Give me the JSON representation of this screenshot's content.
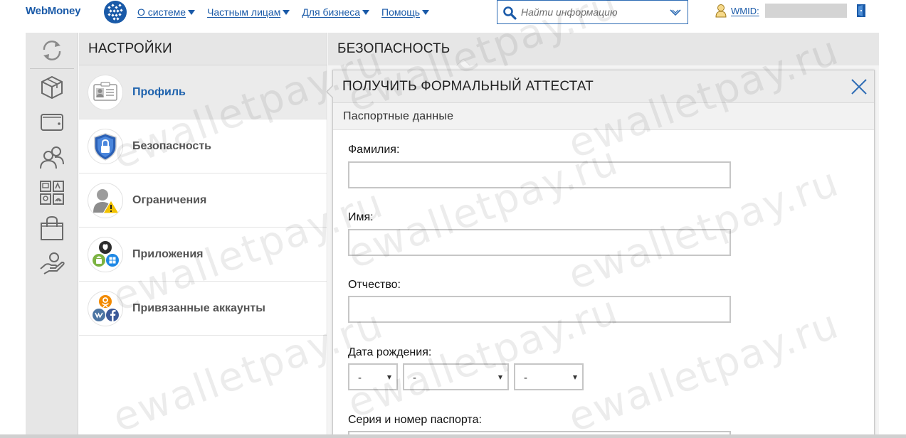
{
  "header": {
    "logo_text": "WebMoney",
    "nav": [
      {
        "label": "О системе"
      },
      {
        "label": "Частным лицам"
      },
      {
        "label": "Для бизнеса"
      },
      {
        "label": "Помощь"
      }
    ],
    "search_placeholder": "Найти информацию",
    "wmid_label": "WMID:"
  },
  "rail_icons": [
    "refresh-icon",
    "box-icon",
    "wallet-icon",
    "contacts-icon",
    "services-icon",
    "bag-icon",
    "hand-coin-icon"
  ],
  "settings": {
    "title": "НАСТРОЙКИ",
    "items": [
      {
        "label": "Профиль",
        "icon": "profile-card-icon",
        "active": true
      },
      {
        "label": "Безопасность",
        "icon": "shield-lock-icon",
        "active": false
      },
      {
        "label": "Ограничения",
        "icon": "user-warning-icon",
        "active": false
      },
      {
        "label": "Приложения",
        "icon": "apps-icon",
        "active": false
      },
      {
        "label": "Привязанные аккаунты",
        "icon": "social-accounts-icon",
        "active": false
      }
    ]
  },
  "security": {
    "title": "БЕЗОПАСНОСТЬ"
  },
  "panel": {
    "title": "ПОЛУЧИТЬ ФОРМАЛЬНЫЙ АТТЕСТАТ",
    "section": "Паспортные данные",
    "fields": {
      "surname_label": "Фамилия:",
      "surname_value": "",
      "name_label": "Имя:",
      "name_value": "",
      "patronymic_label": "Отчество:",
      "patronymic_value": "",
      "birthdate_label": "Дата рождения:",
      "birth_day": "-",
      "birth_month": "-",
      "birth_year": "-",
      "passport_label": "Серия и номер паспорта:"
    }
  },
  "watermark": "ewalletpay.ru",
  "colors": {
    "brand_blue": "#1a5aa8",
    "active_item": "#1e62ad",
    "rail_bg": "#e6e6e6",
    "input_border": "#c6c6c6"
  }
}
